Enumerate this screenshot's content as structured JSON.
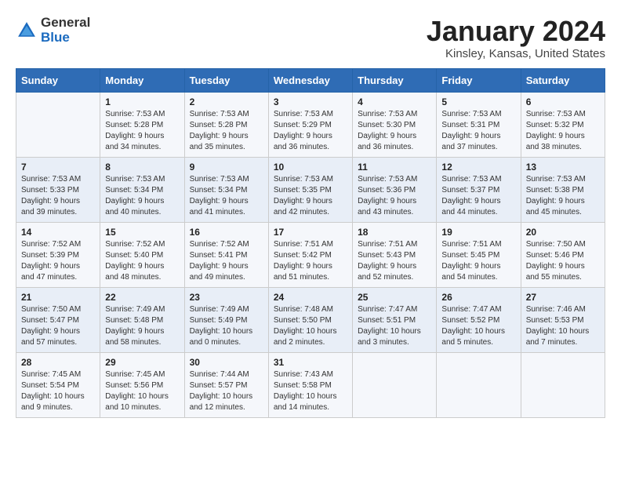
{
  "header": {
    "logo_general": "General",
    "logo_blue": "Blue",
    "month_title": "January 2024",
    "subtitle": "Kinsley, Kansas, United States"
  },
  "days_of_week": [
    "Sunday",
    "Monday",
    "Tuesday",
    "Wednesday",
    "Thursday",
    "Friday",
    "Saturday"
  ],
  "weeks": [
    [
      {
        "day": "",
        "info": ""
      },
      {
        "day": "1",
        "info": "Sunrise: 7:53 AM\nSunset: 5:28 PM\nDaylight: 9 hours\nand 34 minutes."
      },
      {
        "day": "2",
        "info": "Sunrise: 7:53 AM\nSunset: 5:28 PM\nDaylight: 9 hours\nand 35 minutes."
      },
      {
        "day": "3",
        "info": "Sunrise: 7:53 AM\nSunset: 5:29 PM\nDaylight: 9 hours\nand 36 minutes."
      },
      {
        "day": "4",
        "info": "Sunrise: 7:53 AM\nSunset: 5:30 PM\nDaylight: 9 hours\nand 36 minutes."
      },
      {
        "day": "5",
        "info": "Sunrise: 7:53 AM\nSunset: 5:31 PM\nDaylight: 9 hours\nand 37 minutes."
      },
      {
        "day": "6",
        "info": "Sunrise: 7:53 AM\nSunset: 5:32 PM\nDaylight: 9 hours\nand 38 minutes."
      }
    ],
    [
      {
        "day": "7",
        "info": "Sunrise: 7:53 AM\nSunset: 5:33 PM\nDaylight: 9 hours\nand 39 minutes."
      },
      {
        "day": "8",
        "info": "Sunrise: 7:53 AM\nSunset: 5:34 PM\nDaylight: 9 hours\nand 40 minutes."
      },
      {
        "day": "9",
        "info": "Sunrise: 7:53 AM\nSunset: 5:34 PM\nDaylight: 9 hours\nand 41 minutes."
      },
      {
        "day": "10",
        "info": "Sunrise: 7:53 AM\nSunset: 5:35 PM\nDaylight: 9 hours\nand 42 minutes."
      },
      {
        "day": "11",
        "info": "Sunrise: 7:53 AM\nSunset: 5:36 PM\nDaylight: 9 hours\nand 43 minutes."
      },
      {
        "day": "12",
        "info": "Sunrise: 7:53 AM\nSunset: 5:37 PM\nDaylight: 9 hours\nand 44 minutes."
      },
      {
        "day": "13",
        "info": "Sunrise: 7:53 AM\nSunset: 5:38 PM\nDaylight: 9 hours\nand 45 minutes."
      }
    ],
    [
      {
        "day": "14",
        "info": "Sunrise: 7:52 AM\nSunset: 5:39 PM\nDaylight: 9 hours\nand 47 minutes."
      },
      {
        "day": "15",
        "info": "Sunrise: 7:52 AM\nSunset: 5:40 PM\nDaylight: 9 hours\nand 48 minutes."
      },
      {
        "day": "16",
        "info": "Sunrise: 7:52 AM\nSunset: 5:41 PM\nDaylight: 9 hours\nand 49 minutes."
      },
      {
        "day": "17",
        "info": "Sunrise: 7:51 AM\nSunset: 5:42 PM\nDaylight: 9 hours\nand 51 minutes."
      },
      {
        "day": "18",
        "info": "Sunrise: 7:51 AM\nSunset: 5:43 PM\nDaylight: 9 hours\nand 52 minutes."
      },
      {
        "day": "19",
        "info": "Sunrise: 7:51 AM\nSunset: 5:45 PM\nDaylight: 9 hours\nand 54 minutes."
      },
      {
        "day": "20",
        "info": "Sunrise: 7:50 AM\nSunset: 5:46 PM\nDaylight: 9 hours\nand 55 minutes."
      }
    ],
    [
      {
        "day": "21",
        "info": "Sunrise: 7:50 AM\nSunset: 5:47 PM\nDaylight: 9 hours\nand 57 minutes."
      },
      {
        "day": "22",
        "info": "Sunrise: 7:49 AM\nSunset: 5:48 PM\nDaylight: 9 hours\nand 58 minutes."
      },
      {
        "day": "23",
        "info": "Sunrise: 7:49 AM\nSunset: 5:49 PM\nDaylight: 10 hours\nand 0 minutes."
      },
      {
        "day": "24",
        "info": "Sunrise: 7:48 AM\nSunset: 5:50 PM\nDaylight: 10 hours\nand 2 minutes."
      },
      {
        "day": "25",
        "info": "Sunrise: 7:47 AM\nSunset: 5:51 PM\nDaylight: 10 hours\nand 3 minutes."
      },
      {
        "day": "26",
        "info": "Sunrise: 7:47 AM\nSunset: 5:52 PM\nDaylight: 10 hours\nand 5 minutes."
      },
      {
        "day": "27",
        "info": "Sunrise: 7:46 AM\nSunset: 5:53 PM\nDaylight: 10 hours\nand 7 minutes."
      }
    ],
    [
      {
        "day": "28",
        "info": "Sunrise: 7:45 AM\nSunset: 5:54 PM\nDaylight: 10 hours\nand 9 minutes."
      },
      {
        "day": "29",
        "info": "Sunrise: 7:45 AM\nSunset: 5:56 PM\nDaylight: 10 hours\nand 10 minutes."
      },
      {
        "day": "30",
        "info": "Sunrise: 7:44 AM\nSunset: 5:57 PM\nDaylight: 10 hours\nand 12 minutes."
      },
      {
        "day": "31",
        "info": "Sunrise: 7:43 AM\nSunset: 5:58 PM\nDaylight: 10 hours\nand 14 minutes."
      },
      {
        "day": "",
        "info": ""
      },
      {
        "day": "",
        "info": ""
      },
      {
        "day": "",
        "info": ""
      }
    ]
  ]
}
